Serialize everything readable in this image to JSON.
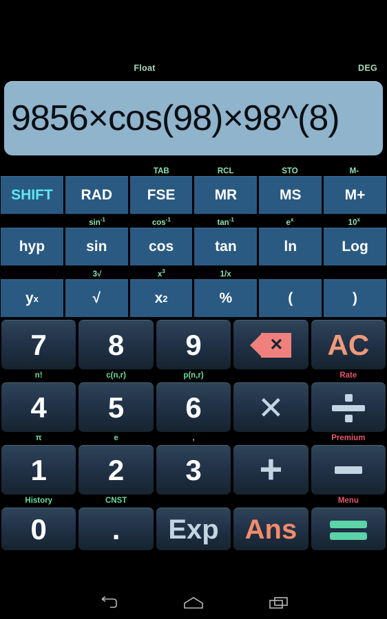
{
  "status": {
    "notation": "Float",
    "angle_mode": "DEG"
  },
  "display": {
    "expression": "9856×cos(98)×98^(8)"
  },
  "colors": {
    "display_bg": "#8fb4cc",
    "function_key_bg": "#2a5a82",
    "shift_text": "#5fe8f0",
    "secondary_label": "#8fe0b4",
    "premium_label": "#e2566b",
    "accent_salmon": "#f58b6b",
    "equals_green": "#5dd3a8",
    "background": "#000000"
  },
  "function_rows": [
    {
      "secondary": [
        "",
        "",
        "TAB",
        "RCL",
        "STO",
        "M-"
      ],
      "keys": [
        {
          "label": "SHIFT",
          "style": "shift"
        },
        {
          "label": "RAD",
          "style": "normal"
        },
        {
          "label": "FSE",
          "style": "normal"
        },
        {
          "label": "MR",
          "style": "normal"
        },
        {
          "label": "MS",
          "style": "normal"
        },
        {
          "label": "M+",
          "style": "normal"
        }
      ]
    },
    {
      "secondary": [
        "",
        "sin-1",
        "cos-1",
        "tan-1",
        "e^x",
        "10^x"
      ],
      "secondary_parts": [
        {
          "base": "",
          "sup": ""
        },
        {
          "base": "sin",
          "sup": "-1"
        },
        {
          "base": "cos",
          "sup": "-1"
        },
        {
          "base": "tan",
          "sup": "-1"
        },
        {
          "base": "e",
          "sup": "x"
        },
        {
          "base": "10",
          "sup": "x"
        }
      ],
      "keys": [
        {
          "label": "hyp",
          "style": "normal"
        },
        {
          "label": "sin",
          "style": "normal"
        },
        {
          "label": "cos",
          "style": "normal"
        },
        {
          "label": "tan",
          "style": "normal"
        },
        {
          "label": "ln",
          "style": "normal"
        },
        {
          "label": "Log",
          "style": "normal"
        }
      ]
    },
    {
      "secondary_parts": [
        {
          "base": "",
          "sup": ""
        },
        {
          "base": "3√",
          "sup": ""
        },
        {
          "base": "x",
          "sup": "3"
        },
        {
          "base": "1/x",
          "sup": ""
        },
        {
          "base": "",
          "sup": ""
        },
        {
          "base": "",
          "sup": ""
        }
      ],
      "keys": [
        {
          "base": "y",
          "sup": "x",
          "style": "normal"
        },
        {
          "base": "√",
          "sup": "",
          "style": "normal"
        },
        {
          "base": "x",
          "sup": "2",
          "style": "normal"
        },
        {
          "base": "%",
          "sup": "",
          "style": "normal"
        },
        {
          "base": "(",
          "sup": "",
          "style": "normal"
        },
        {
          "base": ")",
          "sup": "",
          "style": "normal"
        }
      ]
    }
  ],
  "keypad_rows": [
    {
      "keys": [
        {
          "name": "seven",
          "label": "7",
          "style": "digit"
        },
        {
          "name": "eight",
          "label": "8",
          "style": "digit"
        },
        {
          "name": "nine",
          "label": "9",
          "style": "digit"
        },
        {
          "name": "backspace",
          "label": "",
          "style": "backspace"
        },
        {
          "name": "all-clear",
          "label": "AC",
          "style": "ac"
        }
      ],
      "labels": [
        {
          "text": "n!",
          "color": "green"
        },
        {
          "text": "c(n,r)",
          "color": "green"
        },
        {
          "text": "p(n,r)",
          "color": "green"
        },
        {
          "text": "",
          "color": "green"
        },
        {
          "text": "Rate",
          "color": "red"
        }
      ]
    },
    {
      "keys": [
        {
          "name": "four",
          "label": "4",
          "style": "digit"
        },
        {
          "name": "five",
          "label": "5",
          "style": "digit"
        },
        {
          "name": "six",
          "label": "6",
          "style": "digit"
        },
        {
          "name": "multiply",
          "label": "×",
          "style": "multiply"
        },
        {
          "name": "divide",
          "label": "÷",
          "style": "divide"
        }
      ],
      "labels": [
        {
          "text": "π",
          "color": "green"
        },
        {
          "text": "e",
          "color": "green"
        },
        {
          "text": ",",
          "color": "green"
        },
        {
          "text": "",
          "color": "green"
        },
        {
          "text": "Premium",
          "color": "red"
        }
      ]
    },
    {
      "keys": [
        {
          "name": "one",
          "label": "1",
          "style": "digit"
        },
        {
          "name": "two",
          "label": "2",
          "style": "digit"
        },
        {
          "name": "three",
          "label": "3",
          "style": "digit"
        },
        {
          "name": "plus",
          "label": "+",
          "style": "plus"
        },
        {
          "name": "minus",
          "label": "−",
          "style": "minus"
        }
      ],
      "labels": [
        {
          "text": "History",
          "color": "green"
        },
        {
          "text": "CNST",
          "color": "green"
        },
        {
          "text": "",
          "color": "green"
        },
        {
          "text": "",
          "color": "green"
        },
        {
          "text": "Menu",
          "color": "red"
        }
      ]
    },
    {
      "keys": [
        {
          "name": "zero",
          "label": "0",
          "style": "digit"
        },
        {
          "name": "decimal-point",
          "label": ".",
          "style": "dot"
        },
        {
          "name": "exponent",
          "label": "Exp",
          "style": "exp"
        },
        {
          "name": "answer",
          "label": "Ans",
          "style": "ans"
        },
        {
          "name": "equals",
          "label": "=",
          "style": "equals"
        }
      ],
      "labels": []
    }
  ],
  "navbar": {
    "back": "back-icon",
    "home": "home-icon",
    "recents": "recents-icon"
  }
}
